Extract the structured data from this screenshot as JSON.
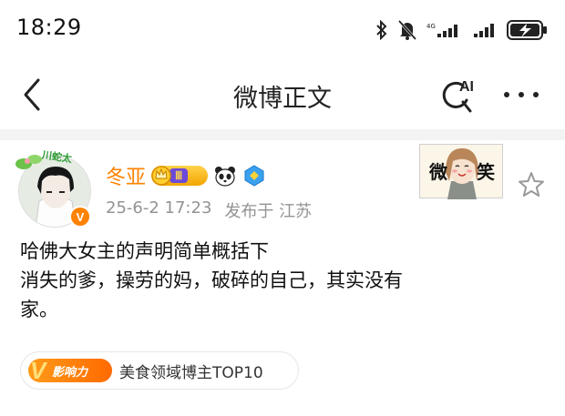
{
  "status_bar": {
    "time": "18:29",
    "icons": [
      "bluetooth-icon",
      "mute-bell-icon",
      "signal-bars-icon",
      "signal-bars-icon",
      "battery-charging-icon"
    ]
  },
  "nav": {
    "back_icon": "chevron-left-icon",
    "title": "微博正文",
    "ai_label": "AI",
    "more_icon": "ellipsis-icon"
  },
  "post": {
    "avatar_frame_text": "川蛇太",
    "verified_badge": "V",
    "username": "冬亚",
    "level_label": "Ⅲ",
    "timestamp": "25-6-2 17:23",
    "location": "发布于 江苏",
    "sticker_chars": [
      "微",
      "笑"
    ],
    "content_lines": [
      "哈佛大女主的声明简单概括下",
      "消失的爹，操劳的妈，破碎的自己，其实没有",
      "家。"
    ],
    "influence": {
      "badge_mark": "V",
      "badge_label": "影响力",
      "text": "美食领域博主TOP10"
    }
  },
  "colors": {
    "accent": "#ff8200",
    "meta_gray": "#939393",
    "divider": "#f3f3f3",
    "level_purple": "#6b4ad8"
  }
}
